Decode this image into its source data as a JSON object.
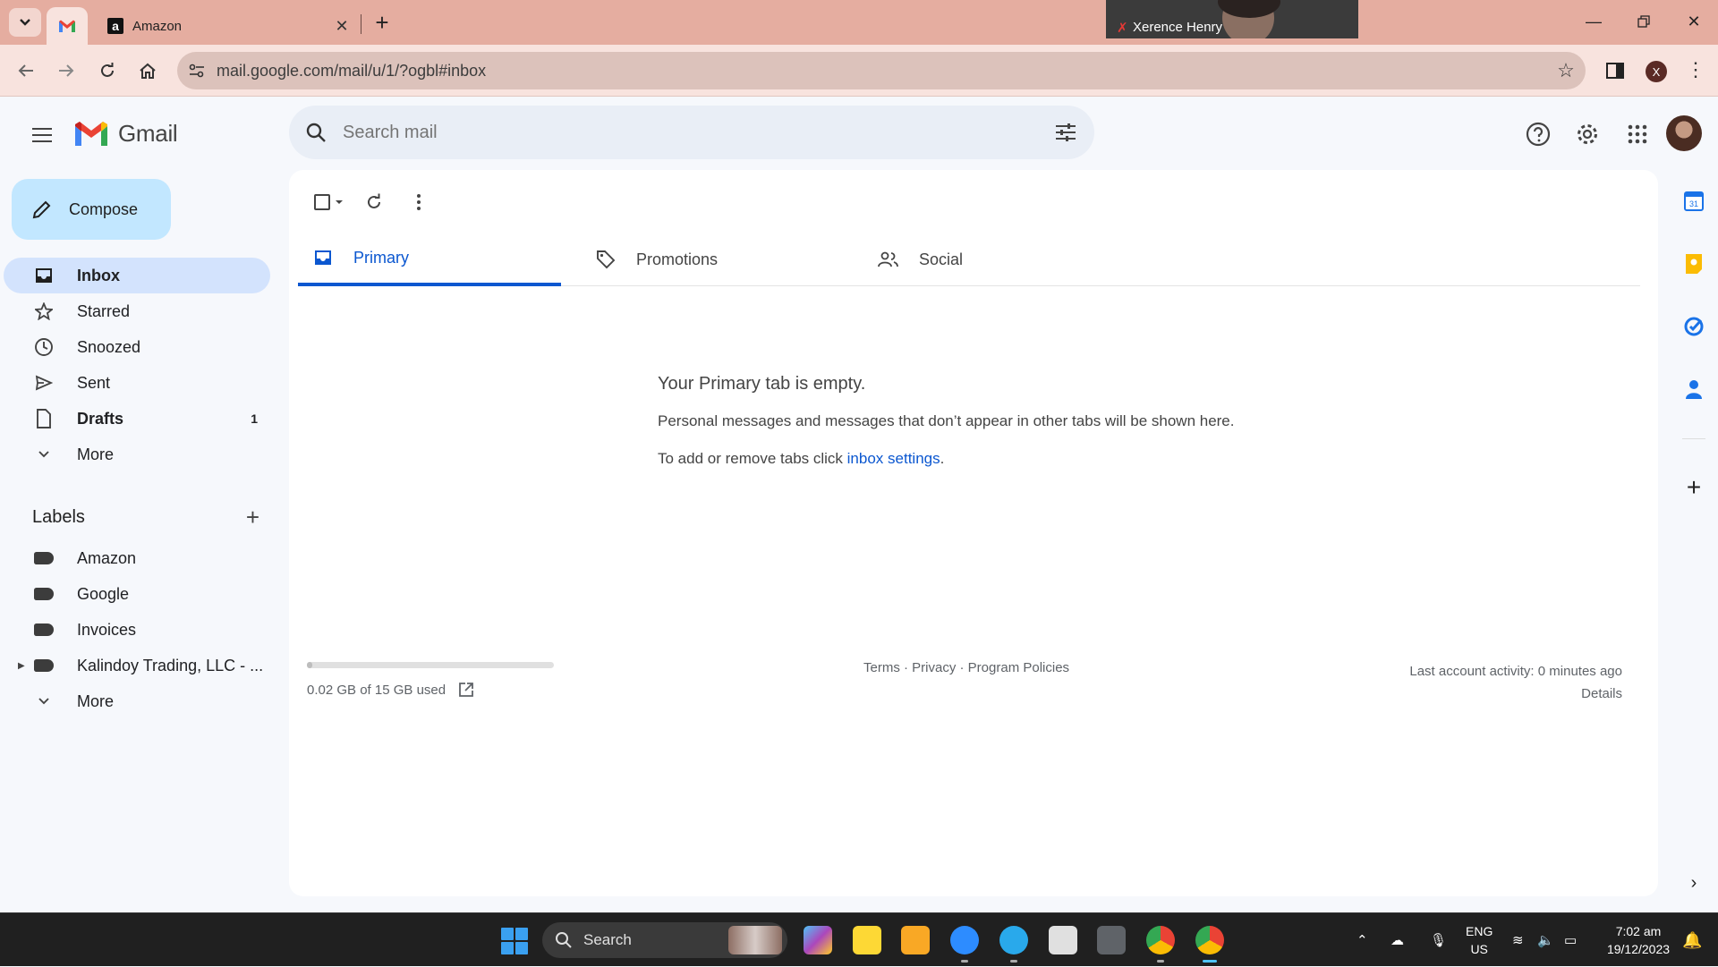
{
  "browser": {
    "tabs": [
      {
        "title": "",
        "icon": "gmail-icon",
        "active": true
      },
      {
        "title": "Amazon",
        "icon": "amazon-icon",
        "active": false
      }
    ],
    "url": "mail.google.com/mail/u/1/?ogbl#inbox",
    "profile_initial": "X",
    "video_overlay_name": "Xerence Henry"
  },
  "gmail": {
    "brand": "Gmail",
    "search_placeholder": "Search mail",
    "compose_label": "Compose",
    "nav": [
      {
        "label": "Inbox",
        "icon": "inbox-icon",
        "count": "",
        "active": true
      },
      {
        "label": "Starred",
        "icon": "star-icon",
        "count": ""
      },
      {
        "label": "Snoozed",
        "icon": "clock-icon",
        "count": ""
      },
      {
        "label": "Sent",
        "icon": "send-icon",
        "count": ""
      },
      {
        "label": "Drafts",
        "icon": "draft-icon",
        "count": "1"
      },
      {
        "label": "More",
        "icon": "chevron-down-icon",
        "count": ""
      }
    ],
    "labels_title": "Labels",
    "labels": [
      {
        "label": "Amazon"
      },
      {
        "label": "Google"
      },
      {
        "label": "Invoices"
      },
      {
        "label": "Kalindoy Trading, LLC - ..."
      }
    ],
    "labels_more": "More",
    "category_tabs": [
      {
        "label": "Primary",
        "icon": "inbox-icon",
        "active": true
      },
      {
        "label": "Promotions",
        "icon": "tag-icon"
      },
      {
        "label": "Social",
        "icon": "people-icon"
      }
    ],
    "empty_state": {
      "heading": "Your Primary tab is empty.",
      "message": "Personal messages and messages that don’t appear in other tabs will be shown here.",
      "settings_prefix": "To add or remove tabs click ",
      "settings_link": "inbox settings",
      "settings_suffix": "."
    },
    "footer": {
      "storage": "0.02 GB of 15 GB used",
      "storage_fraction": 0.0013,
      "links": "Terms · Privacy · Program Policies",
      "activity": "Last account activity: 0 minutes ago",
      "details": "Details"
    }
  },
  "taskbar": {
    "search_label": "Search",
    "lang_top": "ENG",
    "lang_bottom": "US",
    "time": "7:02 am",
    "date": "19/12/2023"
  },
  "colors": {
    "accent": "#0b57d0",
    "compose_bg": "#c2e7ff",
    "active_nav_bg": "#d3e3fd",
    "browser_frame": "#e5ada0"
  }
}
